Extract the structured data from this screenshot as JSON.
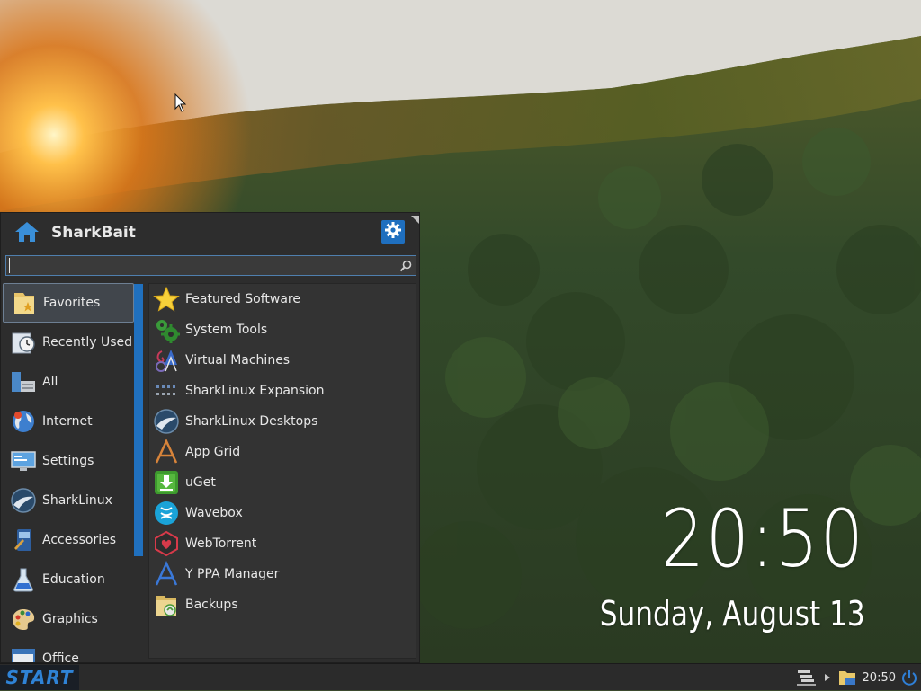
{
  "desktop": {
    "time": "20:50",
    "date": "Sunday, August 13"
  },
  "menu": {
    "user_name": "SharkBait",
    "search": {
      "value": "",
      "placeholder": ""
    },
    "categories": [
      {
        "label": "Favorites",
        "icon": "favorites-folder-icon",
        "active": true
      },
      {
        "label": "Recently Used",
        "icon": "recently-used-icon"
      },
      {
        "label": "All",
        "icon": "all-apps-icon"
      },
      {
        "label": "Internet",
        "icon": "internet-globe-icon"
      },
      {
        "label": "Settings",
        "icon": "settings-monitor-icon"
      },
      {
        "label": "SharkLinux",
        "icon": "sharklinux-icon"
      },
      {
        "label": "Accessories",
        "icon": "accessories-icon"
      },
      {
        "label": "Education",
        "icon": "education-flask-icon"
      },
      {
        "label": "Graphics",
        "icon": "graphics-palette-icon"
      },
      {
        "label": "Office",
        "icon": "office-icon"
      }
    ],
    "apps": [
      {
        "label": "Featured Software",
        "icon": "star-icon"
      },
      {
        "label": "System Tools",
        "icon": "gears-icon"
      },
      {
        "label": "Virtual Machines",
        "icon": "virtual-machines-icon"
      },
      {
        "label": "SharkLinux Expansion",
        "icon": "expansion-dots-icon"
      },
      {
        "label": "SharkLinux Desktops",
        "icon": "sharklinux-desktops-icon"
      },
      {
        "label": "App Grid",
        "icon": "app-grid-icon"
      },
      {
        "label": "uGet",
        "icon": "uget-download-icon"
      },
      {
        "label": "Wavebox",
        "icon": "wavebox-icon"
      },
      {
        "label": "WebTorrent",
        "icon": "webtorrent-icon"
      },
      {
        "label": "Y PPA Manager",
        "icon": "ppa-manager-icon"
      },
      {
        "label": "Backups",
        "icon": "backups-folder-icon"
      }
    ]
  },
  "taskbar": {
    "start_label": "START",
    "clock": "20:50"
  },
  "colors": {
    "accent": "#2070be",
    "menu_bg": "#2d2d2d",
    "app_panel_bg": "#333333"
  }
}
